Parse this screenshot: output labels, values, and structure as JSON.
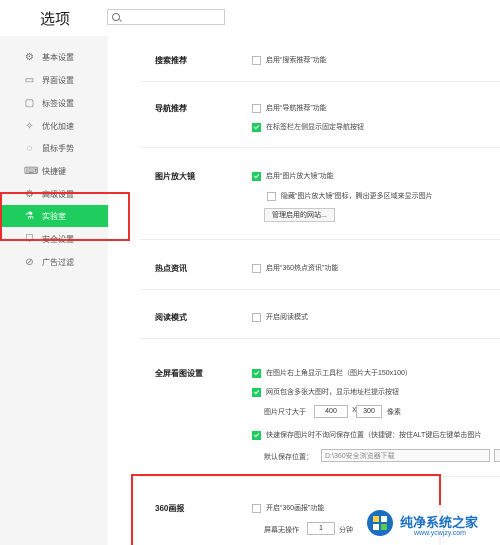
{
  "window": {
    "title": "选项",
    "search_placeholder": ""
  },
  "sidebar": {
    "items": [
      {
        "label": "基本设置",
        "icon": "gear-icon",
        "glyph": "⚙"
      },
      {
        "label": "界面设置",
        "icon": "window-icon",
        "glyph": "▭"
      },
      {
        "label": "标签设置",
        "icon": "tab-icon",
        "glyph": "▢"
      },
      {
        "label": "优化加速",
        "icon": "rocket-icon",
        "glyph": "✧"
      },
      {
        "label": "鼠标手势",
        "icon": "mouse-icon",
        "glyph": "◌"
      },
      {
        "label": "快捷键",
        "icon": "keyboard-icon",
        "glyph": "⌨"
      },
      {
        "label": "高级设置",
        "icon": "advanced-icon",
        "glyph": "⚙"
      },
      {
        "label": "实验室",
        "icon": "flask-icon",
        "glyph": "⚗"
      },
      {
        "label": "安全设置",
        "icon": "shield-icon",
        "glyph": "⛉"
      },
      {
        "label": "广告过滤",
        "icon": "block-icon",
        "glyph": "⊘"
      }
    ],
    "active": "实验室"
  },
  "sections": {
    "search_recommend": {
      "title": "搜索推荐",
      "opt1": "启用“搜索推荐”功能",
      "opt1_checked": false
    },
    "nav_recommend": {
      "title": "导航推荐",
      "opt1": "启用“导航推荐”功能",
      "opt1_checked": false,
      "opt2": "在标签栏左侧显示固定导航按钮",
      "opt2_checked": true
    },
    "magnifier": {
      "title": "图片放大镜",
      "opt1": "启用“图片放大镜”功能",
      "opt1_checked": true,
      "opt2": "隐藏“图片放大镜”图标，腾出更多区域来显示图片",
      "opt2_checked": false,
      "manage_button": "管理启用的网站..."
    },
    "hot_news": {
      "title": "热点资讯",
      "opt1": "启用“360热点资讯”功能",
      "opt1_checked": false
    },
    "reading": {
      "title": "阅读模式",
      "opt1": "开启阅读模式",
      "opt1_checked": false
    },
    "fullscreen": {
      "title": "全屏看图设置",
      "opt1": "在图片右上角显示工具栏（图片大于150x100）",
      "opt1_checked": true,
      "opt2": "网页包含多张大图时，显示地址栏提示按钮",
      "opt2_checked": true,
      "size_label": "图片尺寸大于",
      "width_value": "400",
      "times": "X",
      "height_value": "300",
      "unit": "像素",
      "opt3": "快速保存图片时不询问保存位置（快捷键：按住ALT键后左键单击图片",
      "opt3_checked": true,
      "save_label": "默认保存位置：",
      "save_path": "D:\\360安全浏览器下载"
    },
    "screensaver": {
      "title": "360画报",
      "opt1": "开启“360画报”功能",
      "opt1_checked": false,
      "idle_label": "屏幕无操作",
      "idle_value": "1",
      "idle_unit": "分钟"
    }
  },
  "watermark": {
    "brand": "纯净系统之家",
    "url": "www.ycwjzy.com"
  },
  "colors": {
    "accent": "#1fcd5f",
    "highlight_box": "#e8302f",
    "sidebar_bg": "#f5f5f5"
  }
}
